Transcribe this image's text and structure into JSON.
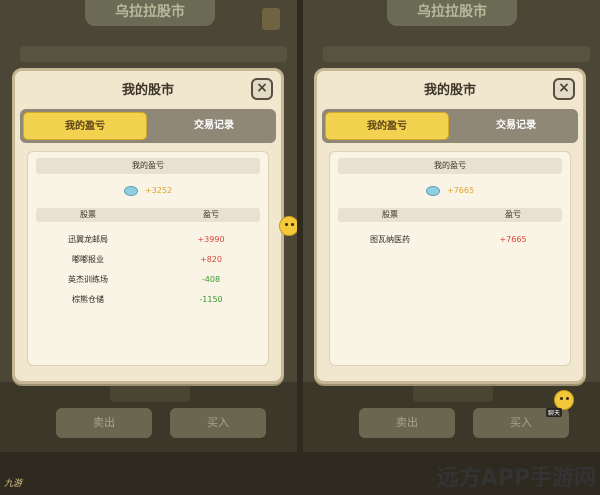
{
  "background": {
    "banner_title": "乌拉拉股市",
    "sell_label": "卖出",
    "buy_label": "买入"
  },
  "left_panel": {
    "title": "我的股市",
    "close_label": "×",
    "tabs": [
      "我的盈亏",
      "交易记录"
    ],
    "summary_label": "我的盈亏",
    "summary_value": "+3252",
    "table_headers": [
      "股票",
      "盈亏"
    ],
    "rows": [
      {
        "name": "迅翼龙邮局",
        "value": "+3990"
      },
      {
        "name": "嘟嘟报业",
        "value": "+820"
      },
      {
        "name": "英杰训练场",
        "value": "-408"
      },
      {
        "name": "棕熊仓储",
        "value": "-1150"
      }
    ]
  },
  "right_panel": {
    "title": "我的股市",
    "close_label": "×",
    "tabs": [
      "我的盈亏",
      "交易记录"
    ],
    "summary_label": "我的盈亏",
    "summary_value": "+7665",
    "table_headers": [
      "股票",
      "盈亏"
    ],
    "rows": [
      {
        "name": "图瓦纳医药",
        "value": "+7665"
      }
    ]
  },
  "chat_label": "聊天",
  "footer": {
    "left_logo": "九游",
    "watermark": "远方APP手游网"
  },
  "colors": {
    "active_tab": "#f3d250",
    "positive": "#d64a3b",
    "negative": "#3a9a2e",
    "gem": "#8fcfe0"
  },
  "icons": {
    "gem": "gem-icon",
    "close": "close-icon",
    "emoji": "emoji-icon"
  }
}
